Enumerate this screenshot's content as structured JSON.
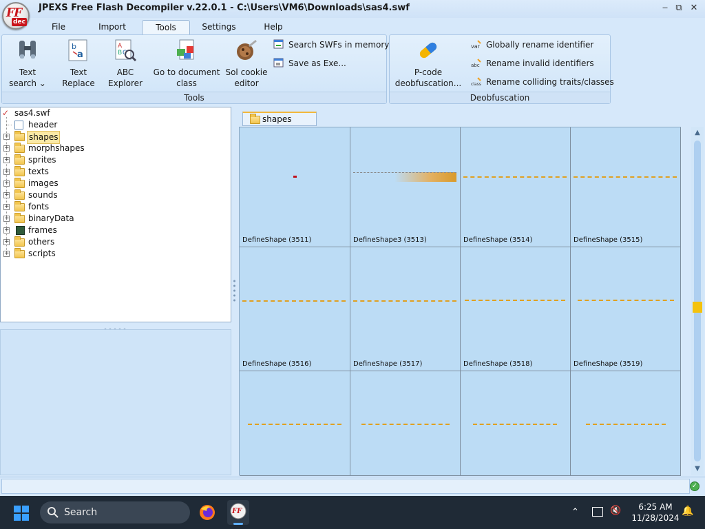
{
  "window": {
    "title": "JPEXS Free Flash Decompiler v.22.0.1 - C:\\Users\\VM6\\Downloads\\sas4.swf",
    "logo_text": "FF",
    "logo_subtext": "dec",
    "controls": [
      "‒",
      "⧉",
      "✕"
    ]
  },
  "menu": {
    "tabs": [
      {
        "label": "File"
      },
      {
        "label": "Import"
      },
      {
        "label": "Tools",
        "active": true
      },
      {
        "label": "Settings"
      },
      {
        "label": "Help"
      }
    ]
  },
  "ribbon": {
    "tools_group": {
      "label": "Tools",
      "text_search": {
        "line1": "Text",
        "line2": "search ⌄"
      },
      "text_replace": {
        "line1": "Text",
        "line2": "Replace"
      },
      "abc_explorer": {
        "line1": "ABC",
        "line2": "Explorer"
      },
      "goto_class": {
        "line1": "Go to document",
        "line2": "class"
      },
      "sol_editor": {
        "line1": "Sol cookie",
        "line2": "editor"
      },
      "search_swfs": "Search SWFs in memory",
      "save_as_exe": "Save as Exe..."
    },
    "deobf_group": {
      "label": "Deobfuscation",
      "pcode": {
        "line1": "P-code",
        "line2": "deobfuscation..."
      },
      "global_rename": "Globally rename identifier",
      "rename_invalid": "Rename invalid identifiers",
      "rename_colliding": "Rename colliding traits/classes"
    }
  },
  "tree": {
    "root": "sas4.swf",
    "items": [
      {
        "label": "header"
      },
      {
        "label": "shapes",
        "selected": true
      },
      {
        "label": "morphshapes"
      },
      {
        "label": "sprites"
      },
      {
        "label": "texts"
      },
      {
        "label": "images"
      },
      {
        "label": "sounds"
      },
      {
        "label": "fonts"
      },
      {
        "label": "binaryData"
      },
      {
        "label": "frames"
      },
      {
        "label": "others"
      },
      {
        "label": "scripts"
      }
    ]
  },
  "content": {
    "tab_label": "shapes",
    "cells": [
      {
        "label": "DefineShape (3511)"
      },
      {
        "label": "DefineShape3 (3513)"
      },
      {
        "label": "DefineShape (3514)"
      },
      {
        "label": "DefineShape (3515)"
      },
      {
        "label": "DefineShape (3516)"
      },
      {
        "label": "DefineShape (3517)"
      },
      {
        "label": "DefineShape (3518)"
      },
      {
        "label": "DefineShape (3519)"
      },
      {
        "label": ""
      },
      {
        "label": ""
      },
      {
        "label": ""
      },
      {
        "label": ""
      }
    ]
  },
  "taskbar": {
    "search_label": "Search",
    "time": "6:25 AM",
    "date": "11/28/2024"
  },
  "colors": {
    "accent": "#f3b73b",
    "shape_orange": "#e0a020",
    "shape_red": "#c0101a"
  }
}
